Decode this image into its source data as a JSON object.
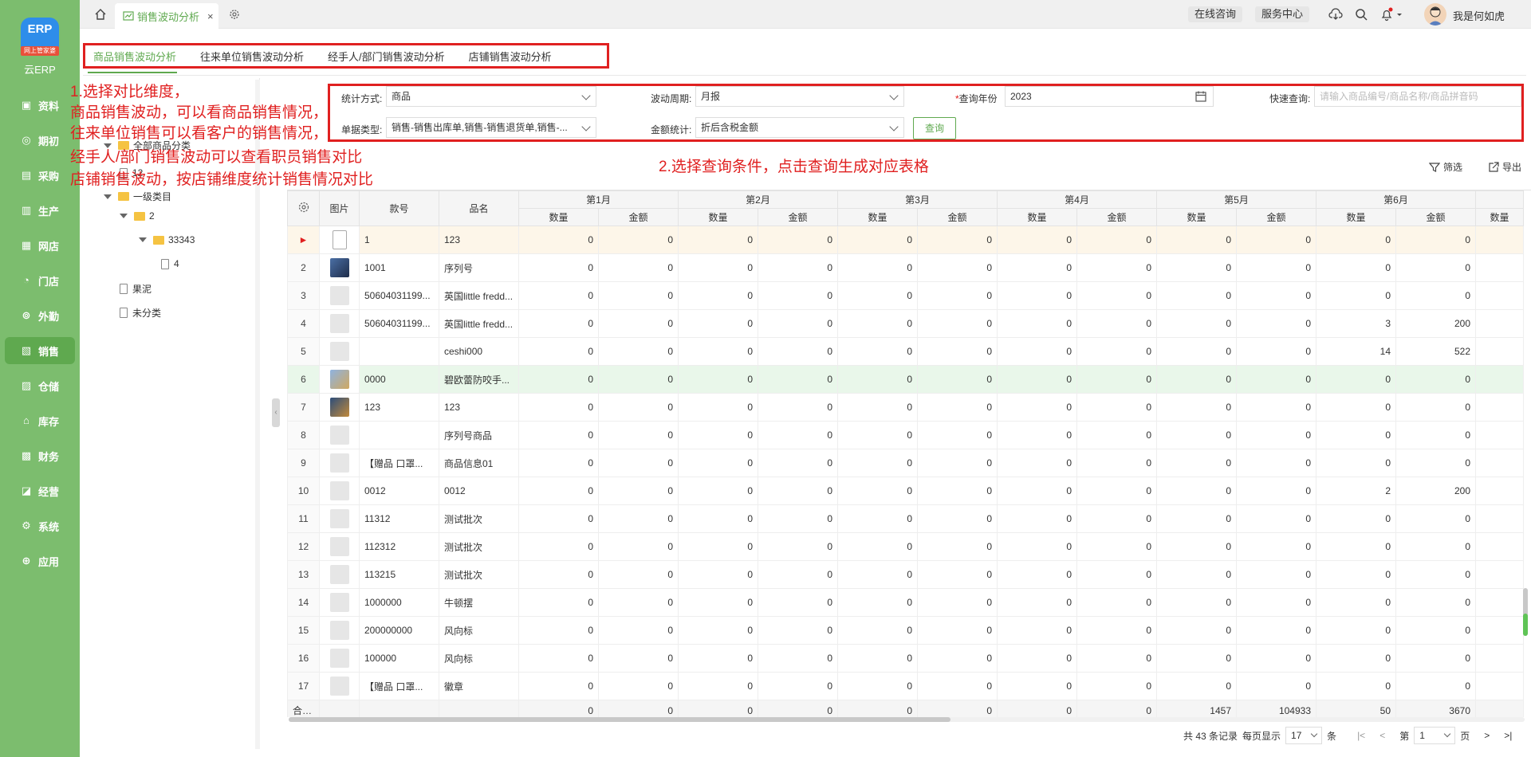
{
  "sidebar": {
    "logo_text": "ERP",
    "logo_tag": "网上管家婆",
    "app_name": "云ERP",
    "items": [
      {
        "label": "资料",
        "icon": "database-icon",
        "glyph": "▣"
      },
      {
        "label": "期初",
        "icon": "target-icon",
        "glyph": "◎"
      },
      {
        "label": "采购",
        "icon": "cart-icon",
        "glyph": "▤"
      },
      {
        "label": "生产",
        "icon": "factory-icon",
        "glyph": "▥"
      },
      {
        "label": "网店",
        "icon": "store-icon",
        "glyph": "▦"
      },
      {
        "label": "门店",
        "icon": "pie-icon",
        "glyph": "◔"
      },
      {
        "label": "外勤",
        "icon": "compass-icon",
        "glyph": "⊚"
      },
      {
        "label": "销售",
        "icon": "sales-icon",
        "glyph": "▧",
        "active": true
      },
      {
        "label": "仓储",
        "icon": "warehouse-icon",
        "glyph": "▨"
      },
      {
        "label": "库存",
        "icon": "stock-icon",
        "glyph": "⌂"
      },
      {
        "label": "财务",
        "icon": "finance-icon",
        "glyph": "▩"
      },
      {
        "label": "经营",
        "icon": "chart-icon",
        "glyph": "◪"
      },
      {
        "label": "系统",
        "icon": "gear-icon",
        "glyph": "⚙"
      },
      {
        "label": "应用",
        "icon": "plus-icon",
        "glyph": "⊕"
      }
    ]
  },
  "topbar": {
    "active_tab": "销售波动分析",
    "close_glyph": "×",
    "online_consult": "在线咨询",
    "service_center": "服务中心",
    "username": "我是何如虎"
  },
  "subtabs": [
    "商品销售波动分析",
    "往来单位销售波动分析",
    "经手人/部门销售波动分析",
    "店铺销售波动分析"
  ],
  "tree": [
    {
      "label": "全部商品分类",
      "type": "folder",
      "caret": true
    },
    {
      "label": "12",
      "type": "file"
    },
    {
      "label": "一级类目",
      "type": "folder",
      "caret": true
    },
    {
      "label": "2",
      "type": "folder",
      "caret": true
    },
    {
      "label": "33343",
      "type": "folder",
      "caret": true
    },
    {
      "label": "4",
      "type": "file"
    },
    {
      "label": "果泥",
      "type": "file"
    },
    {
      "label": "未分类",
      "type": "file"
    }
  ],
  "annotations": {
    "left": [
      "1.选择对比维度，",
      "商品销售波动，可以看商品销售情况，",
      "往来单位销售可以看客户的销售情况，",
      "经手人/部门销售波动可以查看职员销售对比",
      "店铺销售波动，按店铺维度统计销售情况对比"
    ],
    "filter": "2.选择查询条件，点击查询生成对应表格"
  },
  "filters": {
    "stat_method_label": "统计方式:",
    "stat_method_value": "商品",
    "period_label": "波动周期:",
    "period_value": "月报",
    "year_label": "查询年份",
    "year_required": "*",
    "year_value": "2023",
    "quick_label": "快速查询:",
    "quick_placeholder": "请输入商品编号/商品名称/商品拼音码",
    "doc_type_label": "单据类型:",
    "doc_type_value": "销售-销售出库单,销售-销售退货单,销售-...",
    "amount_label": "金额统计:",
    "amount_value": "折后含税金额",
    "query_button": "查询"
  },
  "toolbar": {
    "filter": "筛选",
    "export": "导出"
  },
  "table": {
    "headers": {
      "image": "图片",
      "code": "款号",
      "name": "品名",
      "qty": "数量",
      "amount": "金额",
      "last_partial": "数量"
    },
    "months": [
      "第1月",
      "第2月",
      "第3月",
      "第4月",
      "第5月",
      "第6月"
    ],
    "rows": [
      {
        "no": "",
        "marker": "►",
        "img": "doc",
        "code": "1",
        "name": "123",
        "v": [
          "0",
          "0",
          "0",
          "0",
          "0",
          "0",
          "0",
          "0",
          "0",
          "0",
          "0",
          "0"
        ]
      },
      {
        "no": "2",
        "img": "img",
        "code": "1001",
        "name": "序列号",
        "v": [
          "0",
          "0",
          "0",
          "0",
          "0",
          "0",
          "0",
          "0",
          "0",
          "0",
          "0",
          "0"
        ]
      },
      {
        "no": "3",
        "img": "ph",
        "code": "50604031199...",
        "name": "英国little fredd...",
        "v": [
          "0",
          "0",
          "0",
          "0",
          "0",
          "0",
          "0",
          "0",
          "0",
          "0",
          "0",
          "0"
        ]
      },
      {
        "no": "4",
        "img": "ph",
        "code": "50604031199...",
        "name": "英国little fredd...",
        "v": [
          "0",
          "0",
          "0",
          "0",
          "0",
          "0",
          "0",
          "0",
          "0",
          "0",
          "3",
          "200"
        ]
      },
      {
        "no": "5",
        "img": "ph",
        "code": "",
        "name": "ceshi000",
        "v": [
          "0",
          "0",
          "0",
          "0",
          "0",
          "0",
          "0",
          "0",
          "0",
          "0",
          "14",
          "522"
        ]
      },
      {
        "no": "6",
        "img": "img2",
        "code": "0000",
        "name": "碧欧蕾防咬手...",
        "v": [
          "0",
          "0",
          "0",
          "0",
          "0",
          "0",
          "0",
          "0",
          "0",
          "0",
          "0",
          "0"
        ]
      },
      {
        "no": "7",
        "img": "img3",
        "code": "123",
        "name": "123",
        "v": [
          "0",
          "0",
          "0",
          "0",
          "0",
          "0",
          "0",
          "0",
          "0",
          "0",
          "0",
          "0"
        ]
      },
      {
        "no": "8",
        "img": "ph",
        "code": "",
        "name": "序列号商品",
        "v": [
          "0",
          "0",
          "0",
          "0",
          "0",
          "0",
          "0",
          "0",
          "0",
          "0",
          "0",
          "0"
        ]
      },
      {
        "no": "9",
        "img": "ph",
        "code": "【赠品 口罩...",
        "name": "商品信息01",
        "v": [
          "0",
          "0",
          "0",
          "0",
          "0",
          "0",
          "0",
          "0",
          "0",
          "0",
          "0",
          "0"
        ]
      },
      {
        "no": "10",
        "img": "ph",
        "code": "0012",
        "name": "0012",
        "v": [
          "0",
          "0",
          "0",
          "0",
          "0",
          "0",
          "0",
          "0",
          "0",
          "0",
          "2",
          "200"
        ]
      },
      {
        "no": "11",
        "img": "ph",
        "code": "11312",
        "name": "测试批次",
        "v": [
          "0",
          "0",
          "0",
          "0",
          "0",
          "0",
          "0",
          "0",
          "0",
          "0",
          "0",
          "0"
        ]
      },
      {
        "no": "12",
        "img": "ph",
        "code": "112312",
        "name": "测试批次",
        "v": [
          "0",
          "0",
          "0",
          "0",
          "0",
          "0",
          "0",
          "0",
          "0",
          "0",
          "0",
          "0"
        ]
      },
      {
        "no": "13",
        "img": "ph",
        "code": "113215",
        "name": "测试批次",
        "v": [
          "0",
          "0",
          "0",
          "0",
          "0",
          "0",
          "0",
          "0",
          "0",
          "0",
          "0",
          "0"
        ]
      },
      {
        "no": "14",
        "img": "ph",
        "code": "1000000",
        "name": "牛顿摆",
        "v": [
          "0",
          "0",
          "0",
          "0",
          "0",
          "0",
          "0",
          "0",
          "0",
          "0",
          "0",
          "0"
        ]
      },
      {
        "no": "15",
        "img": "ph",
        "code": "200000000",
        "name": "风向标",
        "v": [
          "0",
          "0",
          "0",
          "0",
          "0",
          "0",
          "0",
          "0",
          "0",
          "0",
          "0",
          "0"
        ]
      },
      {
        "no": "16",
        "img": "ph",
        "code": "100000",
        "name": "风向标",
        "v": [
          "0",
          "0",
          "0",
          "0",
          "0",
          "0",
          "0",
          "0",
          "0",
          "0",
          "0",
          "0"
        ]
      },
      {
        "no": "17",
        "img": "ph",
        "code": "【赠品 口罩...",
        "name": "徽章",
        "v": [
          "0",
          "0",
          "0",
          "0",
          "0",
          "0",
          "0",
          "0",
          "0",
          "0",
          "0",
          "0"
        ]
      }
    ],
    "total_label": "合计:",
    "totals": [
      "0",
      "0",
      "0",
      "0",
      "0",
      "0",
      "0",
      "0",
      "1457",
      "104933",
      "50",
      "3670"
    ]
  },
  "pager": {
    "total": "共 43 条记录",
    "per_page_label": "每页显示",
    "per_page": "17",
    "unit": "条",
    "page_label": "第",
    "page": "1",
    "page_unit": "页",
    "first": "|<",
    "prev": "<",
    "next": ">",
    "last": ">|"
  }
}
